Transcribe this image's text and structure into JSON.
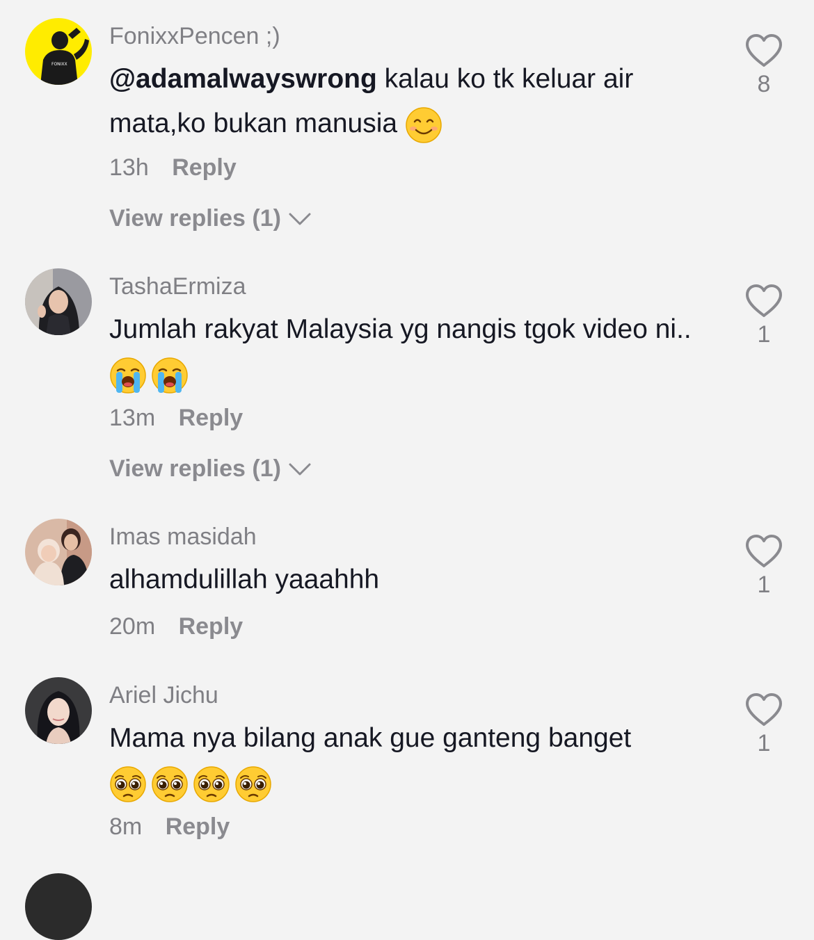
{
  "comments": [
    {
      "username": "FonixxPencen ;)",
      "mention": "@adamalwayswrong",
      "text": "kalau ko tk keluar air mata,ko bukan manusia",
      "emoji_names": [
        "smiling-face-with-smiling-eyes"
      ],
      "time": "13h",
      "reply_label": "Reply",
      "view_replies": "View replies (1)",
      "likes": "8",
      "avatar_caption": "FONIXX"
    },
    {
      "username": "TashaErmiza",
      "text": "Jumlah rakyat Malaysia yg nangis tgok video ni..",
      "emoji_names": [
        "loudly-crying-face",
        "loudly-crying-face"
      ],
      "time": "13m",
      "reply_label": "Reply",
      "view_replies": "View replies (1)",
      "likes": "1"
    },
    {
      "username": "Imas masidah",
      "text": "alhamdulillah yaaahhh",
      "time": "20m",
      "reply_label": "Reply",
      "likes": "1"
    },
    {
      "username": "Ariel Jichu",
      "text": "Mama nya bilang anak gue ganteng banget",
      "emoji_names": [
        "pleading-face",
        "pleading-face",
        "pleading-face",
        "pleading-face"
      ],
      "time": "8m",
      "reply_label": "Reply",
      "likes": "1"
    }
  ],
  "colors": {
    "background": "#f3f3f3",
    "text": "#161823",
    "secondary": "#7f7f84",
    "avatar_yellow": "#ffec00"
  }
}
